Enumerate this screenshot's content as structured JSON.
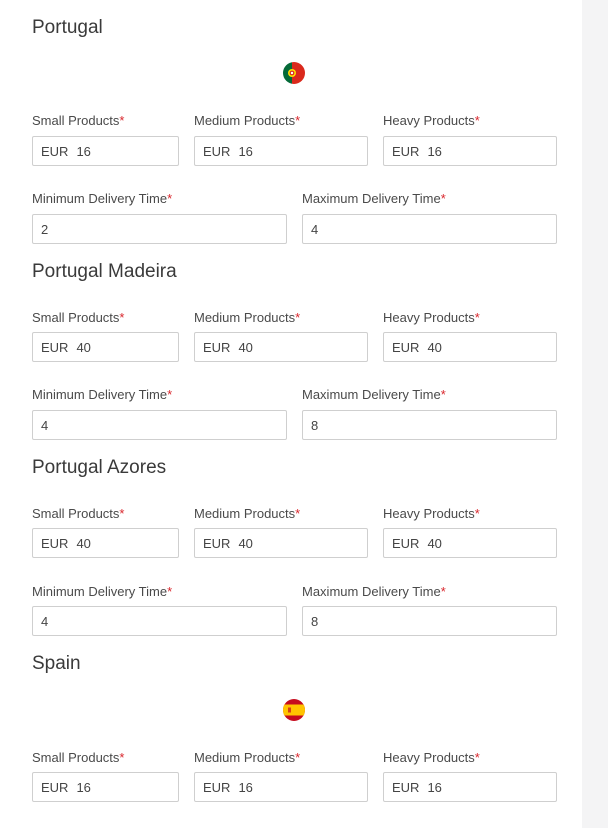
{
  "labels": {
    "small": "Small Products",
    "medium": "Medium Products",
    "heavy": "Heavy Products",
    "min_time": "Minimum Delivery Time",
    "max_time": "Maximum Delivery Time",
    "required": "*"
  },
  "colors": {
    "required": "#d9262c",
    "border": "#cfcfcf",
    "portugal_green": "#046a38",
    "portugal_red": "#da291c",
    "spain_red": "#c60b1e",
    "spain_yellow": "#ffc400"
  },
  "sections": [
    {
      "title": "Portugal",
      "flag_icon": "portugal-flag-icon",
      "small": {
        "currency": "EUR",
        "value": "16"
      },
      "medium": {
        "currency": "EUR",
        "value": "16"
      },
      "heavy": {
        "currency": "EUR",
        "value": "16"
      },
      "min_time": "2",
      "max_time": "4"
    },
    {
      "title": "Portugal Madeira",
      "small": {
        "currency": "EUR",
        "value": "40"
      },
      "medium": {
        "currency": "EUR",
        "value": "40"
      },
      "heavy": {
        "currency": "EUR",
        "value": "40"
      },
      "min_time": "4",
      "max_time": "8"
    },
    {
      "title": "Portugal Azores",
      "small": {
        "currency": "EUR",
        "value": "40"
      },
      "medium": {
        "currency": "EUR",
        "value": "40"
      },
      "heavy": {
        "currency": "EUR",
        "value": "40"
      },
      "min_time": "4",
      "max_time": "8"
    },
    {
      "title": "Spain",
      "flag_icon": "spain-flag-icon",
      "small": {
        "currency": "EUR",
        "value": "16"
      },
      "medium": {
        "currency": "EUR",
        "value": "16"
      },
      "heavy": {
        "currency": "EUR",
        "value": "16"
      }
    }
  ]
}
